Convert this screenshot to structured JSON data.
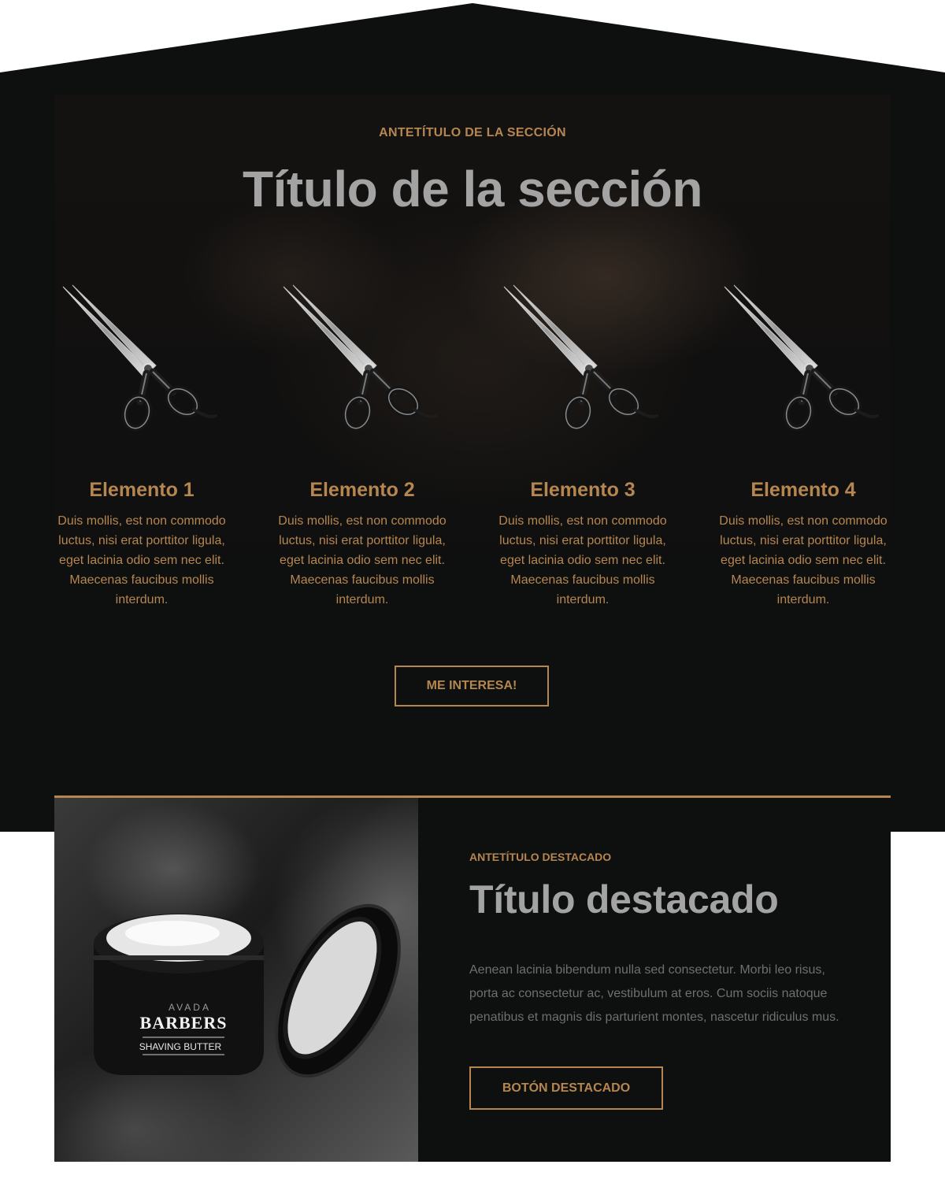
{
  "hero": {
    "eyebrow": "ANTETÍTULO DE LA SECCIÓN",
    "title": "Título de la sección",
    "button_label": "ME INTERESA!",
    "items": [
      {
        "icon": "scissors-icon",
        "title": "Elemento 1",
        "text": "Duis mollis, est non commodo luctus, nisi erat porttitor ligula, eget lacinia odio sem nec elit. Maecenas faucibus mollis interdum."
      },
      {
        "icon": "scissors-icon",
        "title": "Elemento 2",
        "text": "Duis mollis, est non commodo luctus, nisi erat porttitor ligula, eget lacinia odio sem nec elit. Maecenas faucibus mollis interdum."
      },
      {
        "icon": "scissors-icon",
        "title": "Elemento 3",
        "text": "Duis mollis, est non commodo luctus, nisi erat porttitor ligula, eget lacinia odio sem nec elit. Maecenas faucibus mollis interdum."
      },
      {
        "icon": "scissors-icon",
        "title": "Elemento 4",
        "text": "Duis mollis, est non commodo luctus, nisi erat porttitor ligula, eget lacinia odio sem nec elit. Maecenas faucibus mollis interdum."
      }
    ]
  },
  "featured": {
    "product_brand_small": "AVADA",
    "product_brand": "BARBERS",
    "product_name": "SHAVING BUTTER",
    "eyebrow": "ANTETÍTULO DESTACADO",
    "title": "Título destacado",
    "text": "Aenean lacinia bibendum nulla sed consectetur. Morbi leo risus, porta ac consectetur ac, vestibulum at eros. Cum sociis natoque penatibus et magnis dis parturient montes, nascetur ridiculus mus.",
    "button_label": "BOTÓN DESTACADO"
  },
  "colors": {
    "accent": "#b68650",
    "background_dark": "#0e0f0f",
    "title_gray": "#a3a3a3",
    "body_gray": "#6f6f6f",
    "page_background": "#ffffff"
  }
}
